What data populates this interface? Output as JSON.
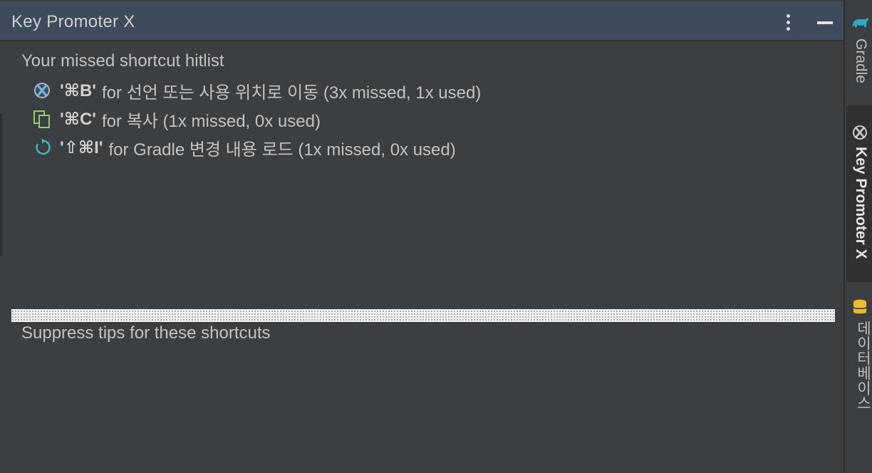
{
  "window": {
    "title": "Key Promoter X"
  },
  "hitlist": {
    "heading": "Your missed shortcut hitlist",
    "items": [
      {
        "icon": "declaration-icon",
        "shortcut": "'⌘B'",
        "text": "for 선언 또는 사용 위치로 이동 (3x missed, 1x used)"
      },
      {
        "icon": "copy-icon",
        "shortcut": "'⌘C'",
        "text": "for 복사 (1x missed, 0x used)"
      },
      {
        "icon": "reload-icon",
        "shortcut": "'⇧⌘I'",
        "text": "for Gradle 변경 내용 로드 (1x missed, 0x used)"
      }
    ]
  },
  "suppress": {
    "heading": "Suppress tips for these shortcuts"
  },
  "side_tabs": [
    {
      "label": "Gradle",
      "icon": "gradle-elephant-icon"
    },
    {
      "label": "Key Promoter X",
      "icon": "key-promoter-icon",
      "active": true
    },
    {
      "label": "데이터베이스",
      "icon": "database-icon"
    }
  ],
  "colors": {
    "title_bar": "#3d4b5c",
    "background": "#3c3f41",
    "gradle_icon": "#2fa8c8",
    "copy_icon": "#8fd15a",
    "reload_icon": "#3fb7c9",
    "database_icon": "#f0b82b"
  }
}
